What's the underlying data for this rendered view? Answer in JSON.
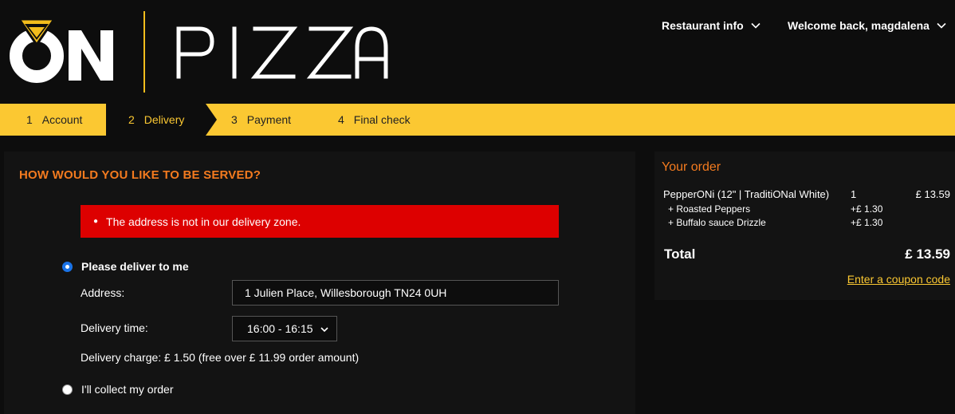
{
  "brand": {
    "logo_mark": "ON",
    "logo_word": "PIZZA",
    "accent_color": "#fbc832",
    "orange_color": "#f47b1f",
    "error_color": "#dd0000"
  },
  "header": {
    "restaurant_info_label": "Restaurant info",
    "welcome_label": "Welcome back, magdalena",
    "chevron_icon": "chevron-down-icon"
  },
  "steps": [
    {
      "num": "1",
      "label": "Account"
    },
    {
      "num": "2",
      "label": "Delivery",
      "active": true
    },
    {
      "num": "3",
      "label": "Payment"
    },
    {
      "num": "4",
      "label": "Final check"
    }
  ],
  "delivery": {
    "title": "HOW WOULD YOU LIKE TO BE SERVED?",
    "error_message": "The address is not in our delivery zone.",
    "deliver_option_label": "Please deliver to me",
    "deliver_option_selected": true,
    "address_label": "Address:",
    "address_value": "1 Julien Place, Willesborough TN24 0UH",
    "time_label": "Delivery time:",
    "time_value": "16:00 - 16:15",
    "charge_text": "Delivery charge: £ 1.50 (free over £ 11.99 order amount)",
    "collect_option_label": "I'll collect my order",
    "collect_option_selected": false
  },
  "order": {
    "title": "Your order",
    "item_name": "PepperONi (12\" | TraditiONal White)",
    "item_qty": "1",
    "item_price": "£ 13.59",
    "extras": [
      {
        "name": "+ Roasted Peppers",
        "price": "+£ 1.30"
      },
      {
        "name": "+ Buffalo sauce Drizzle",
        "price": "+£ 1.30"
      }
    ],
    "total_label": "Total",
    "total_value": "£ 13.59",
    "coupon_label": "Enter a coupon code"
  }
}
